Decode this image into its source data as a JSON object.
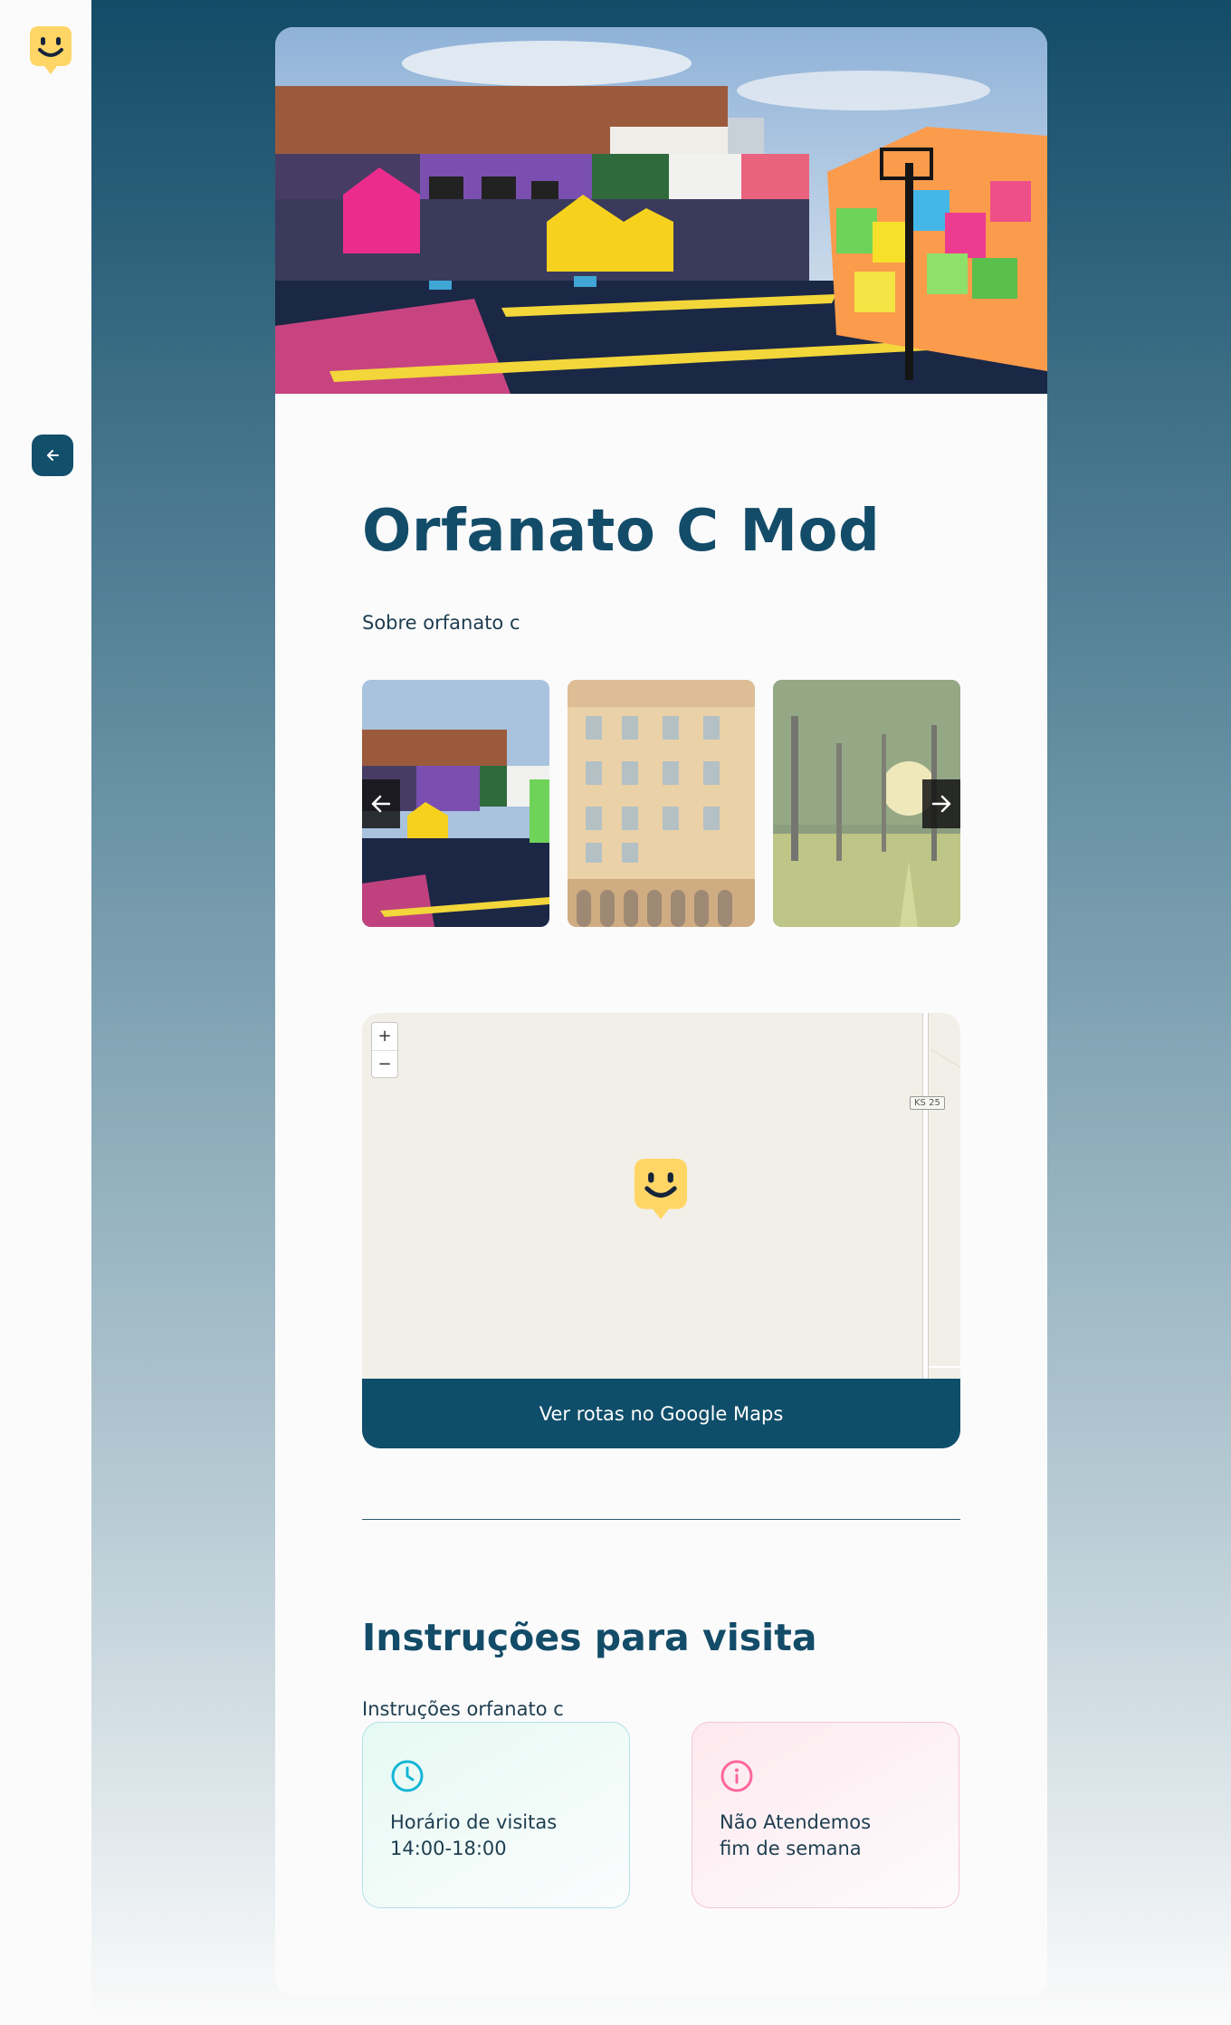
{
  "colors": {
    "brand_dark": "#134c68",
    "button": "#0f4e6a",
    "accent_yellow": "#ffd666",
    "hours_accent": "#15b6d6",
    "closed_accent": "#ff669d"
  },
  "sidebar": {
    "logo_icon": "happy-marker-icon",
    "back_icon": "arrow-left-icon"
  },
  "orphanage": {
    "name": "Orfanato C Mod",
    "about": "Sobre orfanato c",
    "images": [
      "mural-court-photo",
      "building-facade-photo",
      "forest-sunlight-photo"
    ],
    "active_image": 0
  },
  "map": {
    "zoom_in": "+",
    "zoom_out": "−",
    "road_label": "KS 25",
    "directions_button": "Ver rotas no Google Maps"
  },
  "instructions": {
    "heading": "Instruções para visita",
    "text": "Instruções orfanato c",
    "hours_title": "Horário de visitas",
    "hours_value": "14:00-18:00",
    "weekend_line1": "Não Atendemos",
    "weekend_line2": "fim de semana"
  }
}
